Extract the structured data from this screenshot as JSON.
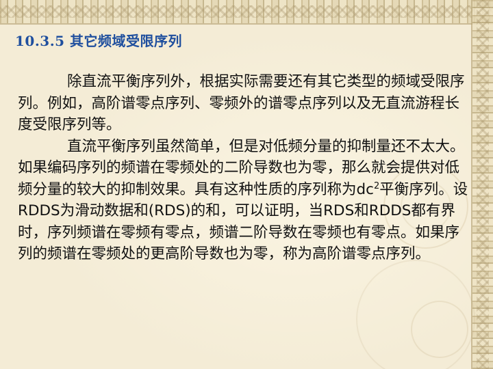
{
  "slide": {
    "title": "10.3.5 其它频域受限序列",
    "paragraph1": "除直流平衡序列外，根据实际需要还有其它类型的频域受限序列。例如，高阶谱零点序列、零频外的谱零点序列以及无直流游程长度受限序列等。",
    "paragraph2_before_sup": "直流平衡序列虽然简单，但是对低频分量的抑制量还不太大。如果编码序列的频谱在零频处的二阶导数也为零，那么就会提供对低频分量的较大的抑制效果。具有这种性质的序列称为dc",
    "paragraph2_sup": "2",
    "paragraph2_after_sup": "平衡序列。设RDDS为滑动数据和(RDS)的和，可以证明，当RDS和RDDS都有界时，序列频谱在零频有零点，频谱二阶导数在零频也有零点。如果序列的频谱在零频处的更高阶导数也为零，称为高阶谱零点序列。"
  },
  "colors": {
    "title": "#1f4f9e",
    "text": "#111111",
    "background": "#f4ecd6"
  }
}
